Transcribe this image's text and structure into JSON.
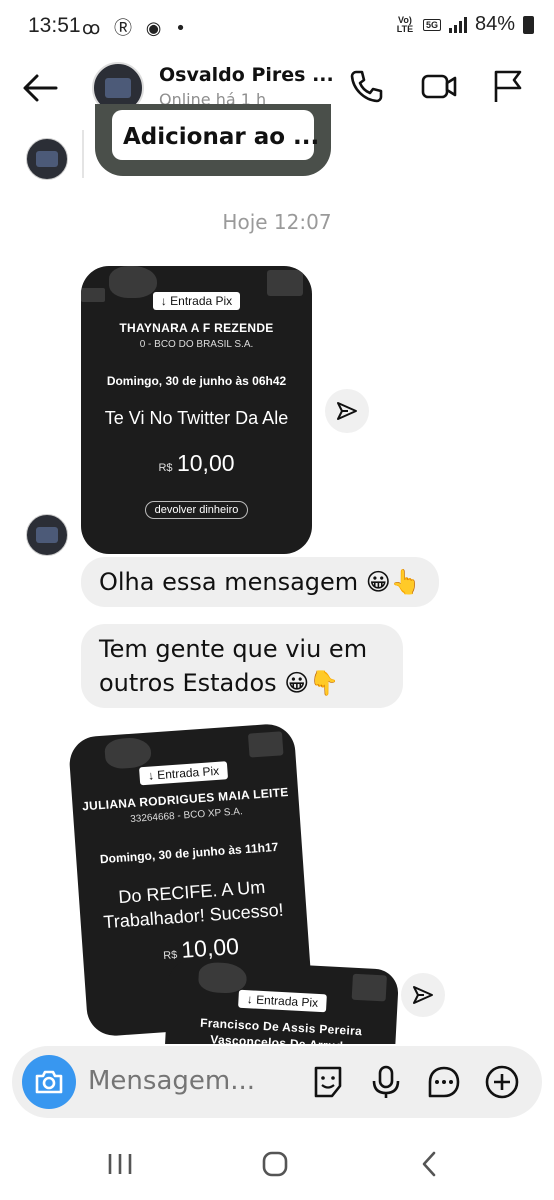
{
  "status_bar": {
    "time": "13:51",
    "left_icons": "ꝏ Ⓡ ◉ •",
    "volte": "Vo) LTE",
    "network": "5G",
    "battery_text": "84%"
  },
  "header": {
    "contact_name": "Osvaldo Pires ...",
    "contact_status": "Online há 1 h"
  },
  "chat": {
    "quoted_preview": "Adicionar ao ...",
    "date_separator": "Hoje 12:07",
    "receipt_1": {
      "tag": "↓ Entrada Pix",
      "name": "THAYNARA A F REZENDE",
      "bank": "0 - BCO DO BRASIL S.A.",
      "date": "Domingo, 30 de junho às 06h42",
      "message": "Te Vi No Twitter Da Ale",
      "currency": "R$",
      "amount": "10,00",
      "button": "devolver dinheiro"
    },
    "bubble_1": "Olha essa mensagem 😀👆",
    "bubble_2_line1": "Tem gente que viu em",
    "bubble_2_line2": "outros Estados 😀👇",
    "receipt_2": {
      "tag": "↓ Entrada Pix",
      "name": "JULIANA RODRIGUES MAIA LEITE",
      "bank": "33264668 - BCO XP S.A.",
      "date": "Domingo, 30 de junho às 11h17",
      "message_line1": "Do RECIFE. A Um",
      "message_line2": "Trabalhador! Sucesso!",
      "currency": "R$",
      "amount": "10,00"
    },
    "receipt_3": {
      "tag": "↓ Entrada Pix",
      "name_line1": "Francisco De Assis Pereira",
      "name_line2": "Vasconcelos De Arruda"
    }
  },
  "composer": {
    "placeholder": "Mensagem..."
  },
  "colors": {
    "accent": "#3897f0",
    "bubble": "#efefef",
    "receipt_bg": "#1c1c1c"
  }
}
